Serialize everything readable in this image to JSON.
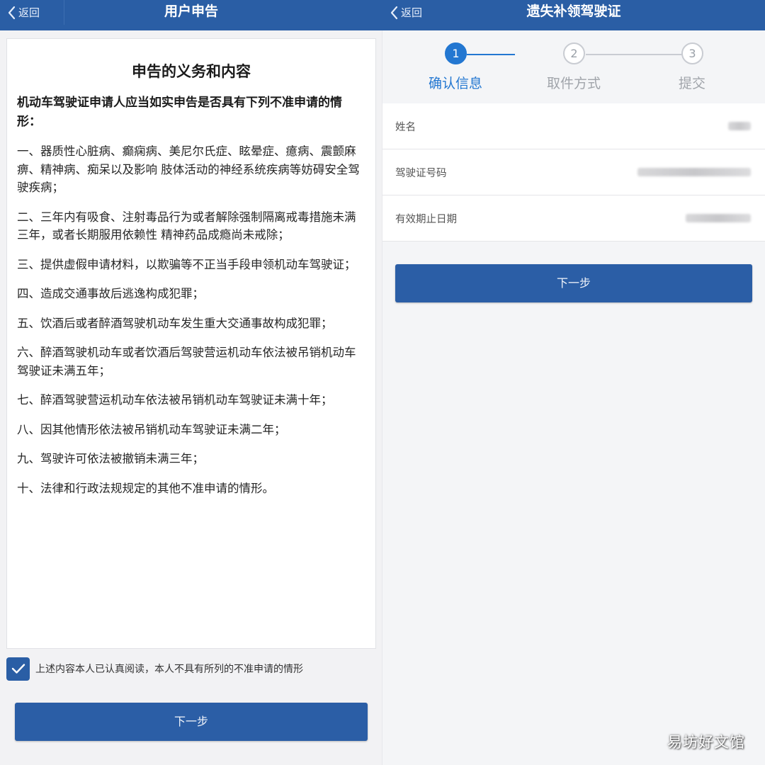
{
  "left": {
    "header": {
      "back_label": "返回",
      "title": "用户申告"
    },
    "card": {
      "title": "申告的义务和内容",
      "lead": "机动车驾驶证申请人应当如实申告是否具有下列不准申请的情形：",
      "items": [
        "一、器质性心脏病、癫痫病、美尼尔氏症、眩晕症、癔病、震颤麻痹、精神病、痴呆以及影响 肢体活动的神经系统疾病等妨碍安全驾驶疾病；",
        "二、三年内有吸食、注射毒品行为或者解除强制隔离戒毒措施未满三年，或者长期服用依赖性 精神药品成瘾尚未戒除；",
        "三、提供虚假申请材料，以欺骗等不正当手段申领机动车驾驶证；",
        "四、造成交通事故后逃逸构成犯罪；",
        "五、饮酒后或者醉酒驾驶机动车发生重大交通事故构成犯罪；",
        "六、醉酒驾驶机动车或者饮酒后驾驶营运机动车依法被吊销机动车驾驶证未满五年；",
        "七、醉酒驾驶营运机动车依法被吊销机动车驾驶证未满十年；",
        "八、因其他情形依法被吊销机动车驾驶证未满二年；",
        "九、驾驶许可依法被撤销未满三年；",
        "十、法律和行政法规规定的其他不准申请的情形。"
      ]
    },
    "agree_text": "上述内容本人已认真阅读，本人不具有所列的不准申请的情形",
    "next_label": "下一步"
  },
  "right": {
    "header": {
      "back_label": "返回",
      "title": "遗失补领驾驶证"
    },
    "steps": [
      {
        "number": "1",
        "label": "确认信息"
      },
      {
        "number": "2",
        "label": "取件方式"
      },
      {
        "number": "3",
        "label": "提交"
      }
    ],
    "fields": [
      {
        "label": "姓名"
      },
      {
        "label": "驾驶证号码"
      },
      {
        "label": "有效期止日期"
      }
    ],
    "next_label": "下一步"
  },
  "watermark": "易坊好文馆",
  "colors": {
    "primary": "#2a5ea5",
    "step_active": "#2377d1",
    "step_idle": "#c9ccd2"
  }
}
